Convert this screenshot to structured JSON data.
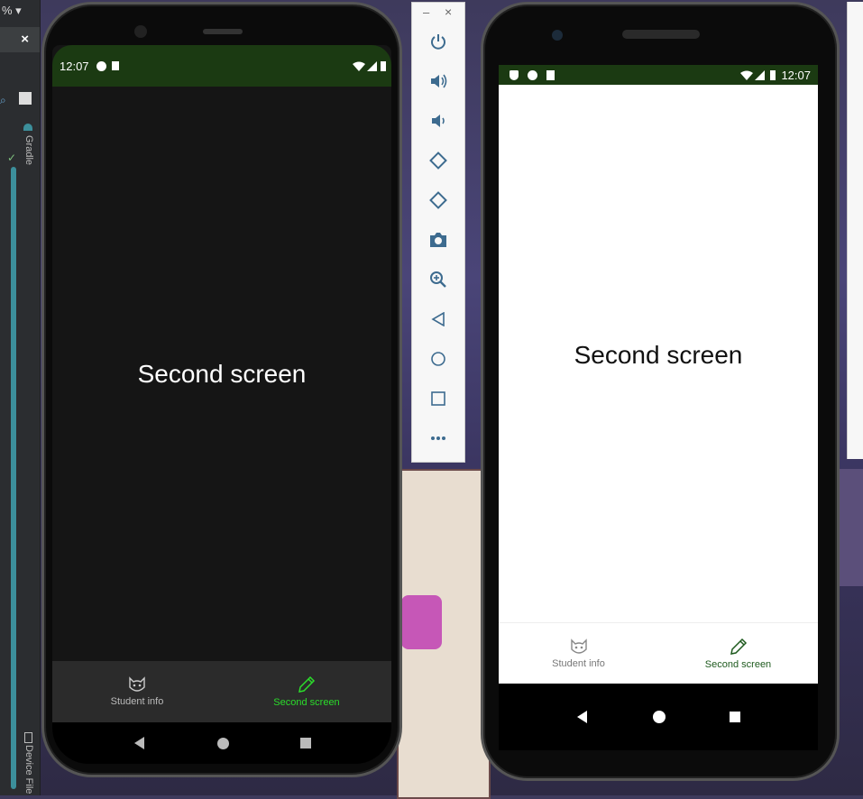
{
  "ide": {
    "zoom_label": "%",
    "close_label": "×",
    "gradle_label": "Gradle",
    "device_file_label": "Device File"
  },
  "left_phone": {
    "status_time": "12:07",
    "screen_title": "Second screen",
    "tabs": [
      {
        "label": "Student info",
        "icon": "cat-face-icon",
        "active": false
      },
      {
        "label": "Second screen",
        "icon": "pencil-icon",
        "active": true
      }
    ],
    "colors": {
      "status_bar": "#1b3a12",
      "background": "#151515",
      "bottom_nav": "#2b2b2b",
      "active_tab": "#2bdc2b"
    }
  },
  "right_phone": {
    "status_time": "12:07",
    "screen_title": "Second screen",
    "tabs": [
      {
        "label": "Student info",
        "icon": "cat-face-icon",
        "active": false
      },
      {
        "label": "Second screen",
        "icon": "pencil-icon",
        "active": true
      }
    ],
    "colors": {
      "status_bar": "#1b3a12",
      "background": "#ffffff",
      "active_tab": "#1e5a1e"
    }
  },
  "toolbar": {
    "minimize_label": "–",
    "close_label": "×",
    "buttons": [
      "power-icon",
      "volume-up-icon",
      "volume-down-icon",
      "rotate-left-icon",
      "rotate-right-icon",
      "camera-icon",
      "zoom-icon",
      "back-icon",
      "home-icon",
      "overview-icon",
      "more-icon"
    ]
  }
}
